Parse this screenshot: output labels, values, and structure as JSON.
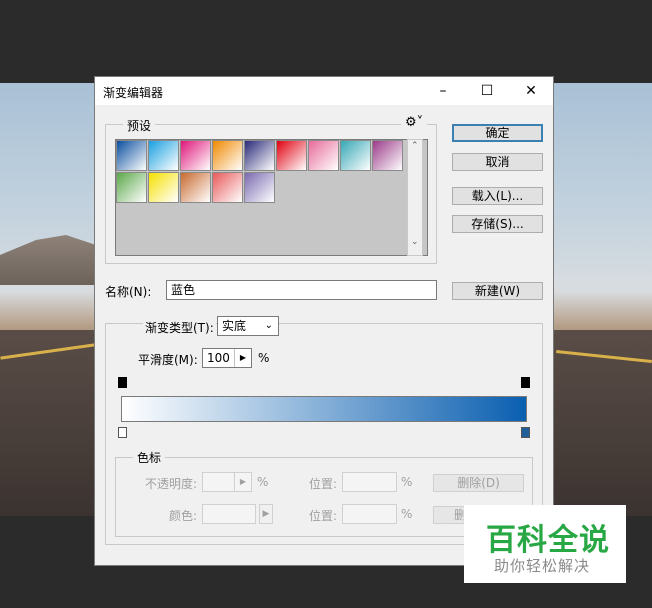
{
  "window": {
    "title": "渐变编辑器"
  },
  "presets": {
    "label": "预设",
    "settings_icon": "gear-icon"
  },
  "buttons": {
    "ok": "确定",
    "cancel": "取消",
    "load": "载入(L)...",
    "save": "存储(S)...",
    "new": "新建(W)",
    "delete": "删除(D)",
    "delete_partial": "删"
  },
  "name": {
    "label": "名称(N):",
    "value": "蓝色"
  },
  "gradient": {
    "type_label": "渐变类型(T):",
    "type_value": "实底",
    "smooth_label": "平滑度(M):",
    "smooth_value": "100",
    "smooth_unit": "%",
    "colors": {
      "start": "#ffffff",
      "end": "#0a5fb0"
    }
  },
  "color_stop": {
    "group_label": "色标",
    "opacity_label": "不透明度:",
    "opacity_unit": "%",
    "position_label": "位置:",
    "position_unit": "%",
    "color_label": "颜色:",
    "position2_label": "位置:",
    "position2_unit": "%"
  },
  "swatches": [
    [
      "#0a4f9e",
      "#ffffff"
    ],
    [
      "#1aa0e0",
      "#ffffff"
    ],
    [
      "#e0177a",
      "#ffffff"
    ],
    [
      "#f08a00",
      "#ffffff"
    ],
    [
      "#2a2a7a",
      "#ffffff"
    ],
    [
      "#e00010",
      "#ffffff"
    ],
    [
      "#e86b9a",
      "#ffffff"
    ],
    [
      "#35a7b5",
      "#ffffff"
    ],
    [
      "#9b3a8a",
      "#ffffff"
    ],
    [
      "#5ca84a",
      "#ffffff"
    ],
    [
      "#f5e000",
      "#ffffff"
    ],
    [
      "#c86a30",
      "#ffffff"
    ],
    [
      "#e85a5a",
      "#ffffff"
    ],
    [
      "#7a6ab0",
      "#ffffff"
    ]
  ],
  "watermark": {
    "main": "百科全说",
    "sub": "助你轻松解决"
  }
}
